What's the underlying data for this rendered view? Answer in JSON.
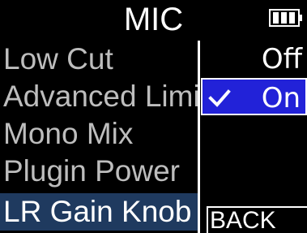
{
  "title": "MIC",
  "status": {
    "battery_icon": "battery-full-icon"
  },
  "menu": {
    "items": [
      {
        "label": "Low Cut"
      },
      {
        "label": "Advanced Limiter"
      },
      {
        "label": "Mono Mix"
      },
      {
        "label": "Plugin Power"
      },
      {
        "label": "LR Gain Knob",
        "active": true
      }
    ]
  },
  "options": {
    "items": [
      {
        "label": "Off",
        "selected": false
      },
      {
        "label": "On",
        "selected": true,
        "check_icon": "checkmark-icon"
      }
    ]
  },
  "back_button": {
    "label": "BACK"
  },
  "colors": {
    "background": "#000000",
    "text": "#ffffff",
    "menu_text": "#bdbdbd",
    "highlight": "#1f3a5f",
    "selected_option": "#2222d8"
  }
}
